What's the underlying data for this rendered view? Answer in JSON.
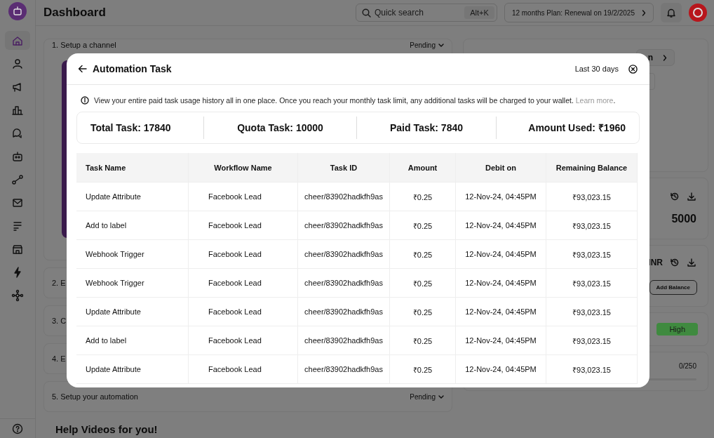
{
  "sidebar": {
    "items": [
      {
        "selected": true
      },
      {
        "selected": false
      },
      {
        "selected": false
      },
      {
        "selected": false
      },
      {
        "selected": false
      },
      {
        "selected": false
      },
      {
        "selected": false
      },
      {
        "selected": false
      },
      {
        "selected": false
      },
      {
        "selected": false
      },
      {
        "selected": false
      },
      {
        "selected": false
      }
    ]
  },
  "header": {
    "title": "Dashboard",
    "search_placeholder": "Quick search",
    "shortcut": "Alt+K",
    "plan": "12 months Plan: Renewal on 19/2/2025"
  },
  "steps": [
    {
      "label": "1. Setup a channel",
      "status": "Pending"
    },
    {
      "label": "2. E"
    },
    {
      "label": "3. C"
    },
    {
      "label": "4. E"
    },
    {
      "label": "5. Setup your automation",
      "status": "Pending"
    }
  ],
  "help_heading": "Help Videos for you!",
  "right_panel": {
    "button_fragment": "n",
    "balance": "5000",
    "currency": "INR",
    "add_balance": "Add Balance",
    "badge": "High",
    "counter": "0/250",
    "usage": {
      "level": 0
    }
  },
  "modal": {
    "title": "Automation Task",
    "range": "Last 30 days",
    "info": "View your entire paid task usage history all in one place. Once you reach your monthly task limit, any additional tasks will be charged to your wallet.",
    "info_link": "Learn more",
    "info_end": ".",
    "stats": [
      "Total Task: 17840",
      "Quota Task: 10000",
      "Paid Task: 7840",
      "Amount Used: ₹1960"
    ],
    "table": {
      "columns": [
        "Task Name",
        "Workflow Name",
        "Task ID",
        "Amount",
        "Debit on",
        "Remaining Balance"
      ],
      "rows": [
        [
          "Update Attribute",
          "Facebook Lead",
          "cheer/83902hadkfh9as",
          "₹0.25",
          "12-Nov-24, 04:45PM",
          "₹93,023.15"
        ],
        [
          "Add to label",
          "Facebook Lead",
          "cheer/83902hadkfh9as",
          "₹0.25",
          "12-Nov-24, 04:45PM",
          "₹93,023.15"
        ],
        [
          "Webhook Trigger",
          "Facebook Lead",
          "cheer/83902hadkfh9as",
          "₹0.25",
          "12-Nov-24, 04:45PM",
          "₹93,023.15"
        ],
        [
          "Webhook Trigger",
          "Facebook Lead",
          "cheer/83902hadkfh9as",
          "₹0.25",
          "12-Nov-24, 04:45PM",
          "₹93,023.15"
        ],
        [
          "Update Attribute",
          "Facebook Lead",
          "cheer/83902hadkfh9as",
          "₹0.25",
          "12-Nov-24, 04:45PM",
          "₹93,023.15"
        ],
        [
          "Add to label",
          "Facebook Lead",
          "cheer/83902hadkfh9as",
          "₹0.25",
          "12-Nov-24, 04:45PM",
          "₹93,023.15"
        ],
        [
          "Update Attribute",
          "Facebook Lead",
          "cheer/83902hadkfh9as",
          "₹0.25",
          "12-Nov-24, 04:45PM",
          "₹93,023.15"
        ]
      ]
    }
  }
}
